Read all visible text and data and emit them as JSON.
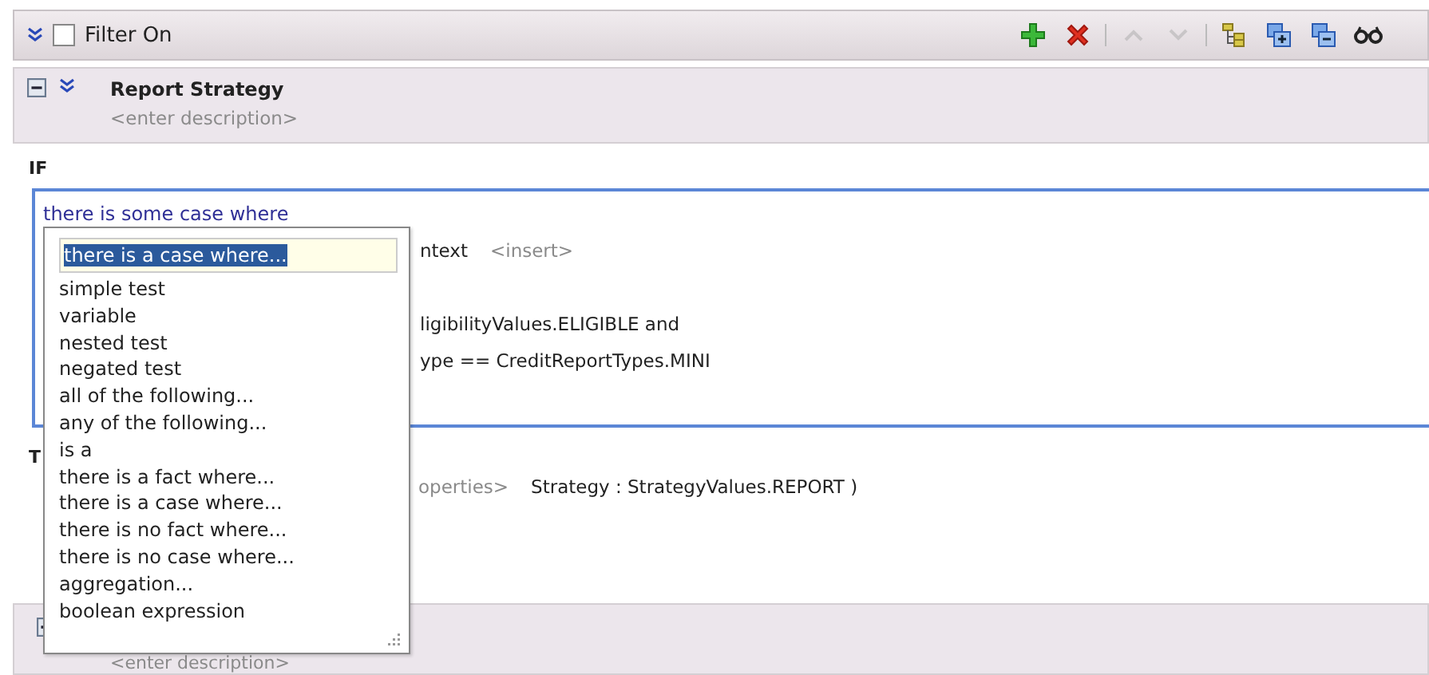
{
  "toolbar": {
    "filter": {
      "label": "Filter On",
      "checked": false
    },
    "buttons": [
      {
        "kind": "add"
      },
      {
        "kind": "delete"
      },
      {
        "kind": "separator"
      },
      {
        "kind": "up",
        "disabled": true
      },
      {
        "kind": "down",
        "disabled": true
      },
      {
        "kind": "separator"
      },
      {
        "kind": "tree"
      },
      {
        "kind": "expand"
      },
      {
        "kind": "collapse"
      },
      {
        "kind": "glasses"
      }
    ]
  },
  "rule": {
    "title": "Report Strategy",
    "description": "<enter description>",
    "expanded": true
  },
  "if_section": {
    "label": "IF",
    "lines": [
      {
        "parts": [
          {
            "text": "there is some case where",
            "kind": "clause"
          }
        ]
      },
      {
        "parts": [
          {
            "text": "ntext",
            "kind": "code"
          },
          {
            "text": "<insert>",
            "kind": "hint"
          }
        ]
      },
      {
        "parts": [
          {
            "text": "ligibilityValues.ELIGIBLE and",
            "kind": "code"
          }
        ]
      },
      {
        "parts": [
          {
            "text": "ype  ==  CreditReportTypes.MINI",
            "kind": "code"
          }
        ]
      }
    ]
  },
  "popup": {
    "value": "there is a case where...",
    "items": [
      "simple test",
      "variable",
      "nested test",
      "negated test",
      "all of the following...",
      "any of the following...",
      "is a",
      "there is a fact where...",
      "there is a case where...",
      "there is no fact where...",
      "there is no case where...",
      "aggregation...",
      "boolean expression"
    ]
  },
  "then_section": {
    "label": "T",
    "lines": [
      {
        "parts": [
          {
            "text": "operties>",
            "kind": "hint"
          },
          {
            "text": "Strategy : StrategyValues.REPORT  )",
            "kind": "code"
          }
        ]
      }
    ]
  },
  "next_rule": {
    "description": "<enter description>"
  }
}
